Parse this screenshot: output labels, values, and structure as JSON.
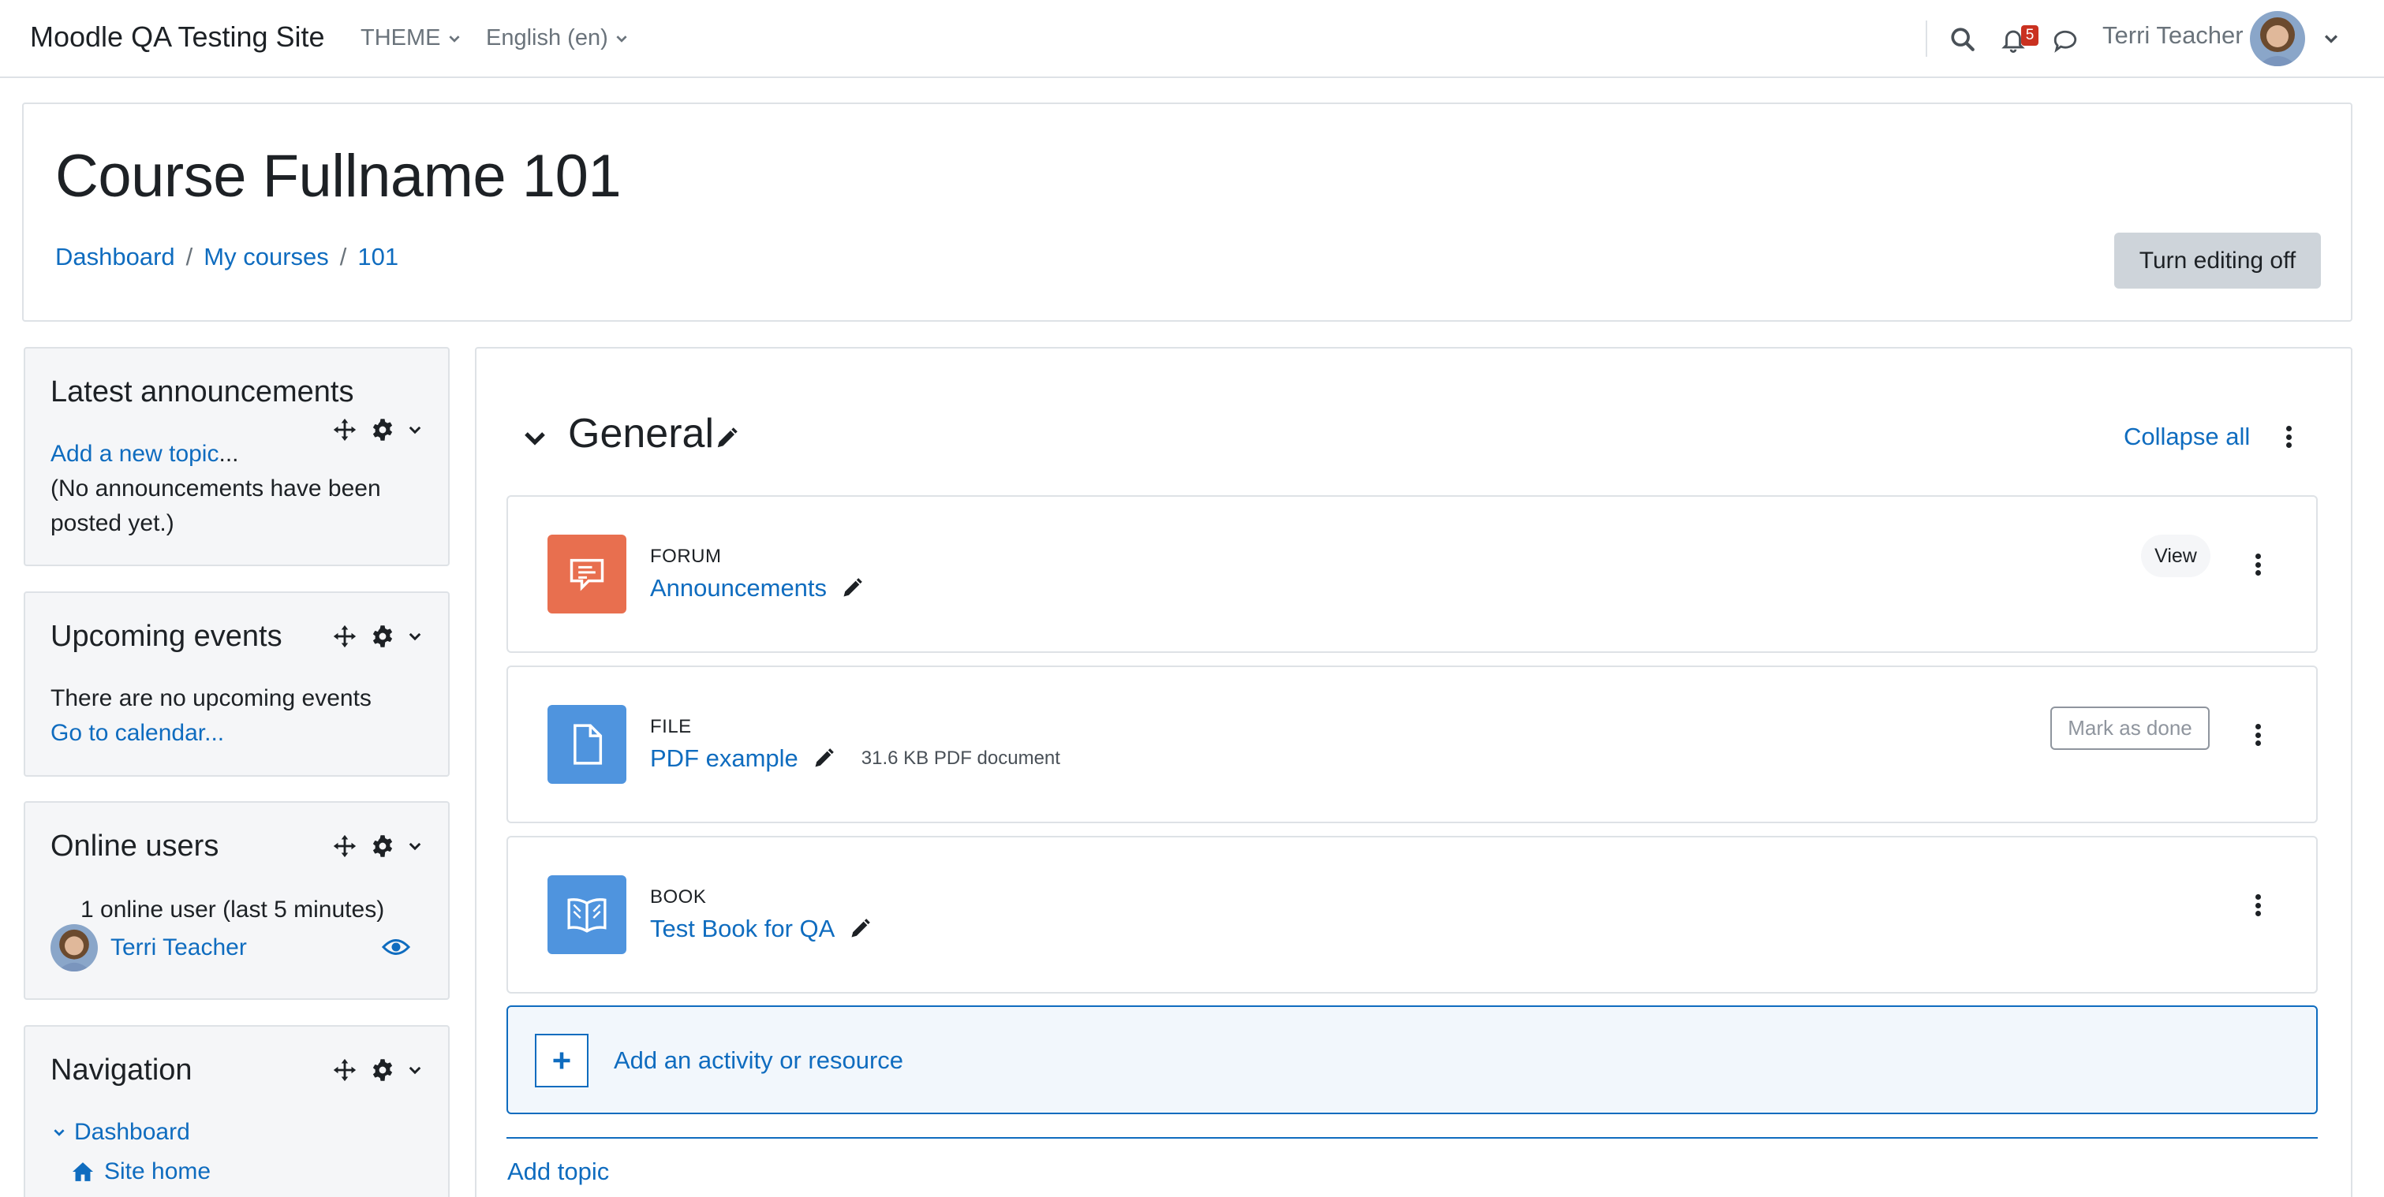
{
  "navbar": {
    "site_name": "Moodle QA Testing Site",
    "theme_menu": "THEME",
    "language_menu": "English (en)",
    "notification_count": "5",
    "user_name": "Terri Teacher"
  },
  "header": {
    "course_title": "Course Fullname 101",
    "breadcrumb": [
      "Dashboard",
      "My courses",
      "101"
    ],
    "breadcrumb_separator": "/",
    "editing_button": "Turn editing off"
  },
  "blocks": {
    "announcements": {
      "title": "Latest announcements",
      "add_link": "Add a new topic",
      "add_link_suffix": "...",
      "empty_text": "(No announcements have been posted yet.)"
    },
    "events": {
      "title": "Upcoming events",
      "empty_text": "There are no upcoming events",
      "calendar_link": "Go to calendar..."
    },
    "online_users": {
      "title": "Online users",
      "summary": "1 online user (last 5 minutes)",
      "user_name": "Terri Teacher"
    },
    "navigation": {
      "title": "Navigation",
      "items": [
        "Dashboard",
        "Site home"
      ]
    }
  },
  "section": {
    "title": "General",
    "collapse_all": "Collapse all",
    "activities": [
      {
        "type": "FORUM",
        "name": "Announcements",
        "action": "View",
        "icon": "forum-icon",
        "icon_color": "#e86f4f"
      },
      {
        "type": "FILE",
        "name": "PDF example",
        "meta": "31.6 KB PDF document",
        "action": "Mark as done",
        "icon": "file-icon",
        "icon_color": "#4f94de"
      },
      {
        "type": "BOOK",
        "name": "Test Book for QA",
        "icon": "book-icon",
        "icon_color": "#4f94de"
      }
    ],
    "add_activity": "Add an activity or resource",
    "add_topic": "Add topic"
  },
  "colors": {
    "link": "#0f6cbf",
    "block_bg": "#f5f6f8",
    "border": "#dee2e6",
    "badge": "#ca3120"
  }
}
